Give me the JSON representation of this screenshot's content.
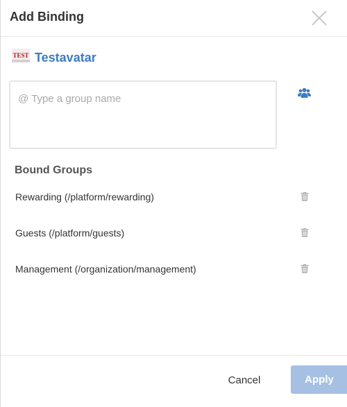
{
  "dialog": {
    "title": "Add Binding",
    "close_icon": "close-icon"
  },
  "entity": {
    "avatar_text": "TEST",
    "name": "Testavatar"
  },
  "group_input": {
    "value": "",
    "placeholder": "@ Type a group name"
  },
  "group_picker_icon": "users-icon",
  "bound_groups": {
    "title": "Bound Groups",
    "items": [
      {
        "label": "Rewarding (/platform/rewarding)"
      },
      {
        "label": "Guests (/platform/guests)"
      },
      {
        "label": "Management (/organization/management)"
      }
    ],
    "remove_icon": "trash-icon"
  },
  "footer": {
    "cancel_label": "Cancel",
    "apply_label": "Apply"
  },
  "colors": {
    "accent": "#3d7bbf",
    "apply_disabled": "#a6c0e4",
    "icon_gray": "#b3b3b3"
  }
}
